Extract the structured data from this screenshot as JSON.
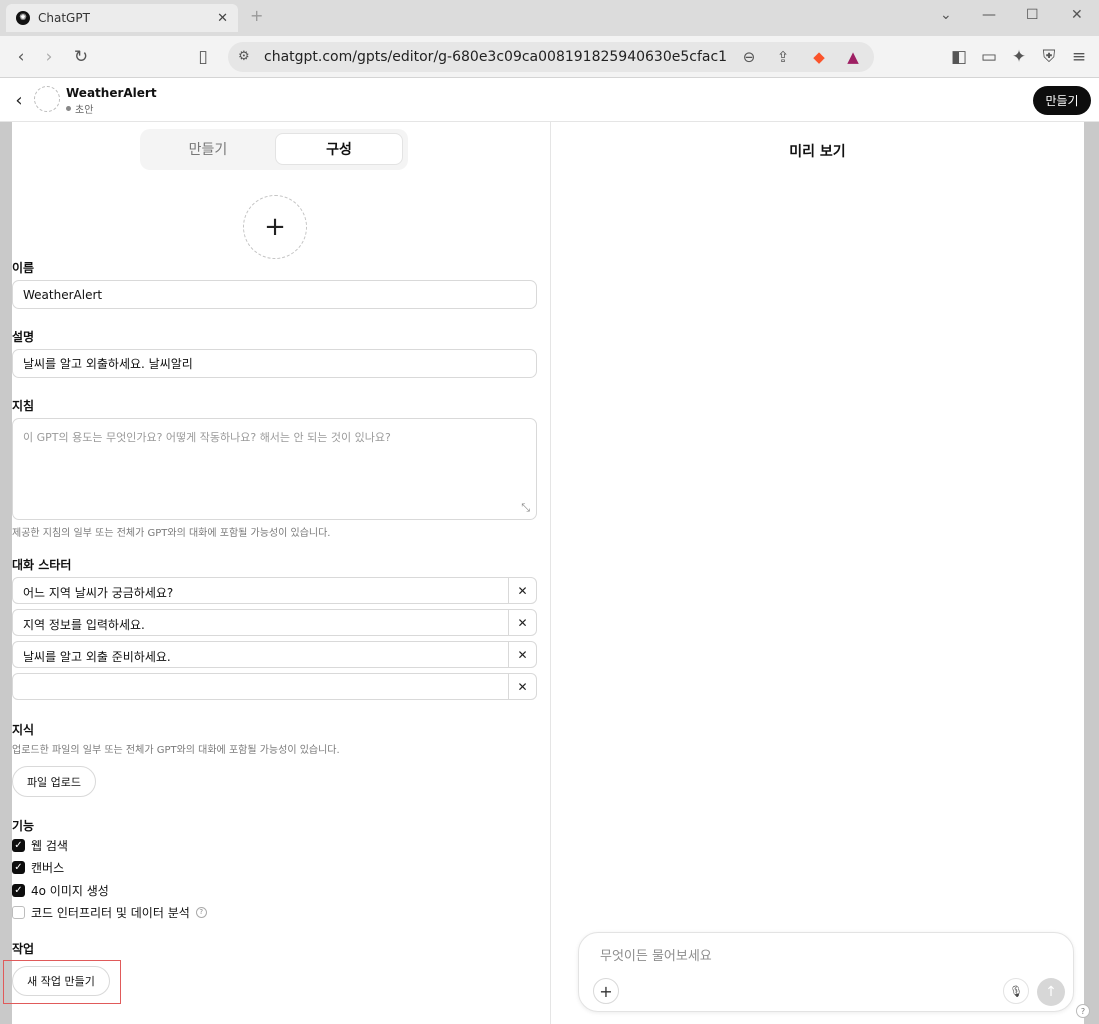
{
  "browser": {
    "tab_title": "ChatGPT",
    "tab_close": "✕",
    "new_tab": "+",
    "url": "chatgpt.com/gpts/editor/g-680e3c09ca008191825940630e5cfac1",
    "window_controls": {
      "minimize": "—",
      "maximize": "☐",
      "close": "✕",
      "tabs_menu": "⌄"
    }
  },
  "header": {
    "back": "‹",
    "gpt_name": "WeatherAlert",
    "status": "초안",
    "create_button": "만들기"
  },
  "editor": {
    "tabs": [
      {
        "label": "만들기"
      },
      {
        "label": "구성"
      }
    ],
    "avatar_plus": "+",
    "name": {
      "label": "이름",
      "value": "WeatherAlert"
    },
    "description": {
      "label": "설명",
      "value": "날씨를 알고 외출하세요. 날씨알리"
    },
    "instructions": {
      "label": "지침",
      "placeholder": "이 GPT의 용도는 무엇인가요? 어떻게 작동하나요? 해서는 안 되는 것이 있나요?",
      "hint": "제공한 지침의 일부 또는 전체가 GPT와의 대화에 포함될 가능성이 있습니다."
    },
    "starters": {
      "label": "대화 스타터",
      "items": [
        {
          "text": "어느 지역 날씨가 궁금하세요?"
        },
        {
          "text": "지역 정보를 입력하세요."
        },
        {
          "text": "날씨를 알고 외출 준비하세요."
        },
        {
          "text": ""
        }
      ],
      "remove_glyph": "✕"
    },
    "knowledge": {
      "label": "지식",
      "hint": "업로드한 파일의 일부 또는 전체가 GPT와의 대화에 포함될 가능성이 있습니다.",
      "upload_button": "파일 업로드"
    },
    "capabilities": {
      "label": "기능",
      "items": [
        {
          "label": "웹 검색",
          "checked": true
        },
        {
          "label": "캔버스",
          "checked": true
        },
        {
          "label": "4o 이미지 생성",
          "checked": true
        },
        {
          "label": "코드 인터프리터 및 데이터 분석",
          "checked": false
        }
      ],
      "help_glyph": "?"
    },
    "actions": {
      "label": "작업",
      "new_button": "새 작업 만들기"
    }
  },
  "preview": {
    "title": "미리 보기",
    "composer_placeholder": "무엇이든 물어보세요"
  },
  "colors": {
    "accent": "#0d0d0d",
    "highlight": "#e05a5a",
    "chrome": "#dcdcdc"
  },
  "icons": [
    "back-icon",
    "forward-icon",
    "reload-icon",
    "bookmark-icon",
    "site-settings-icon",
    "zoom-out-icon",
    "share-icon",
    "brave-shield-icon",
    "brave-rewards-icon",
    "sidebar-icon",
    "wallet-icon",
    "leo-ai-icon",
    "vpn-icon",
    "menu-icon",
    "plus-icon",
    "mic-icon",
    "send-icon",
    "help-icon"
  ]
}
